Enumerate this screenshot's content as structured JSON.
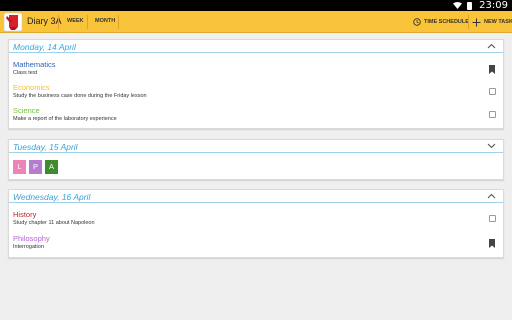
{
  "status_bar": {
    "time": "23:09"
  },
  "action_bar": {
    "title": "Diary 3A",
    "tabs": [
      {
        "label": "WEEK"
      },
      {
        "label": "MONTH"
      }
    ],
    "actions": {
      "time_schedule": "TIME SCHEDULE",
      "new_task": "NEW TASK"
    }
  },
  "days": [
    {
      "date": "Monday, 14 April",
      "tasks": [
        {
          "title": "Mathematics",
          "note": "Class test",
          "color": "#2f5fb4",
          "marker": "bookmark"
        },
        {
          "title": "Economics",
          "note": "Study the business case done during the Friday lesson",
          "color": "#f2c135",
          "marker": "checkbox"
        },
        {
          "title": "Science",
          "note": "Make a report of the laboratory experience",
          "color": "#7ac142",
          "marker": "checkbox"
        }
      ]
    },
    {
      "date": "Tuesday, 15 April",
      "tags": [
        {
          "letter": "L",
          "color": "#ef82b7"
        },
        {
          "letter": "P",
          "color": "#b77bd1"
        },
        {
          "letter": "A",
          "color": "#3f8b2f"
        }
      ]
    },
    {
      "date": "Wednesday, 16 April",
      "tasks": [
        {
          "title": "History",
          "note": "Study chapter 11 about Napoleon",
          "color": "#c8202c",
          "marker": "checkbox"
        },
        {
          "title": "Philosophy",
          "note": "Interrogation",
          "color": "#b565d6",
          "marker": "bookmark"
        }
      ]
    }
  ],
  "colors": {
    "accent_bar": "#f9c33a",
    "date_heading": "#3ba3d6"
  }
}
